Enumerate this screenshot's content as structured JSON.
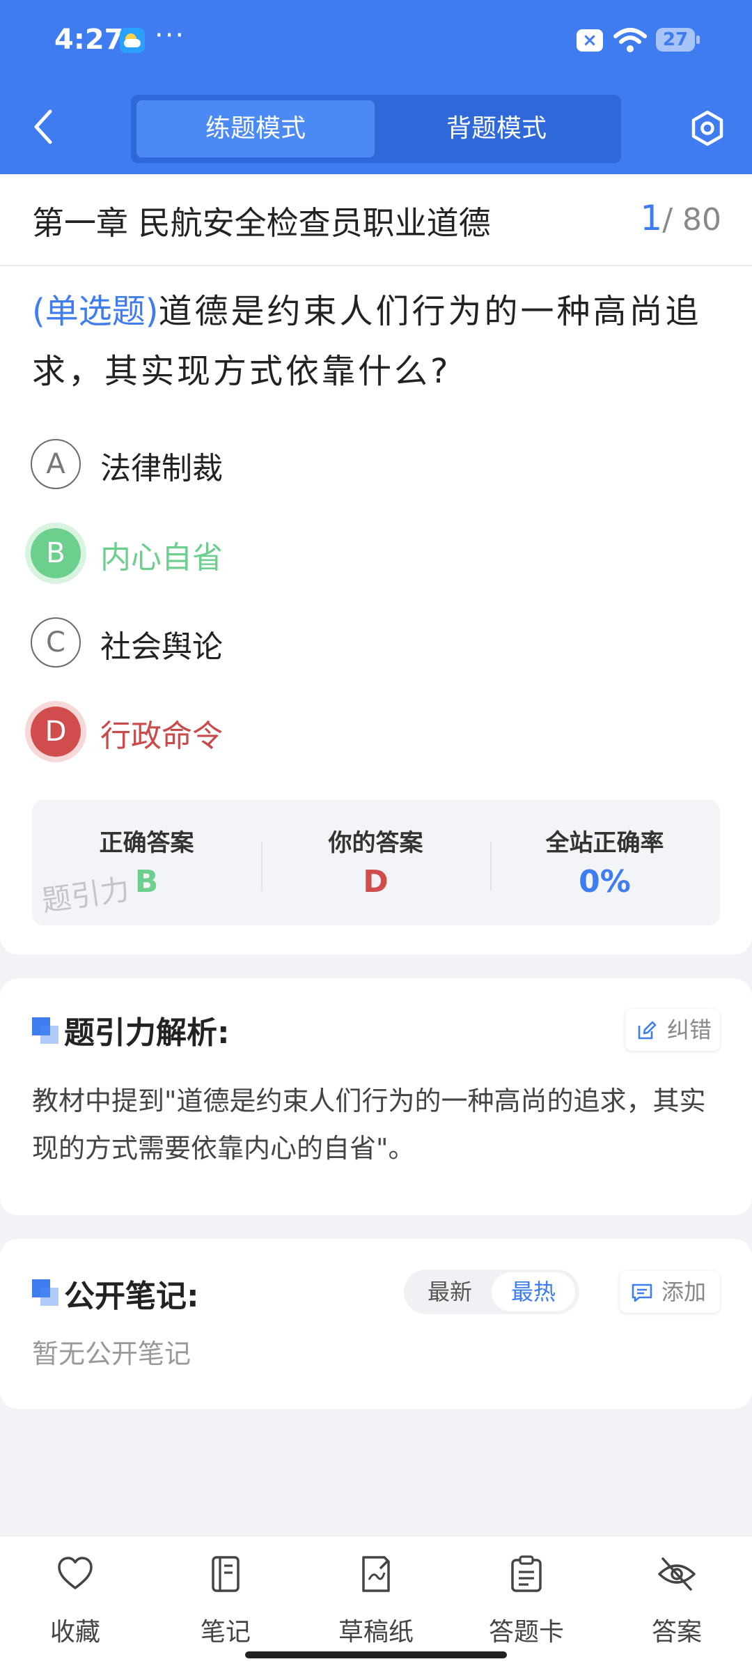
{
  "status_bar": {
    "time": "4:27",
    "dots": "···",
    "battery": "27"
  },
  "header": {
    "mode_tabs": [
      "练题模式",
      "背题模式"
    ],
    "active_tab": 0
  },
  "chapter": {
    "title": "第一章 民航安全检查员职业道德",
    "current": "1",
    "total": "/ 80"
  },
  "question": {
    "type_label": "(单选题)",
    "text": "道德是约束人们行为的一种高尚追求，其实现方式依靠什么?",
    "options": [
      {
        "letter": "A",
        "text": "法律制裁",
        "state": "normal"
      },
      {
        "letter": "B",
        "text": "内心自省",
        "state": "correct"
      },
      {
        "letter": "C",
        "text": "社会舆论",
        "state": "normal"
      },
      {
        "letter": "D",
        "text": "行政命令",
        "state": "wrong"
      }
    ]
  },
  "stats": {
    "correct_label": "正确答案",
    "correct_value": "B",
    "yours_label": "你的答案",
    "yours_value": "D",
    "rate_label": "全站正确率",
    "rate_value": "0%"
  },
  "watermark": "题引力",
  "analysis": {
    "title": "题引力解析:",
    "report_button": "纠错",
    "text": "教材中提到\"道德是约束人们行为的一种高尚的追求，其实现的方式需要依靠内心的自省\"。"
  },
  "notes": {
    "title": "公开笔记:",
    "sort_options": [
      "最新",
      "最热"
    ],
    "active_sort": 1,
    "add_button": "添加",
    "empty_text": "暂无公开笔记"
  },
  "bottom_nav": [
    {
      "label": "收藏",
      "icon": "heart-icon"
    },
    {
      "label": "笔记",
      "icon": "notebook-icon"
    },
    {
      "label": "草稿纸",
      "icon": "draft-icon"
    },
    {
      "label": "答题卡",
      "icon": "clipboard-icon"
    },
    {
      "label": "答案",
      "icon": "eye-off-icon"
    }
  ],
  "colors": {
    "primary": "#3e7cf0",
    "correct": "#6ccf8e",
    "wrong": "#d14c4c"
  }
}
